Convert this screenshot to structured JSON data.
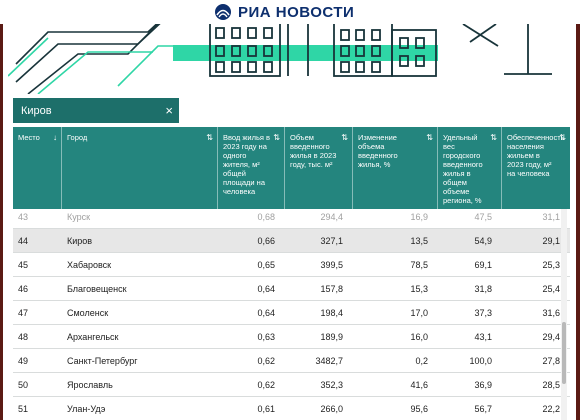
{
  "header": {
    "brand": "РИА НОВОСТИ"
  },
  "search": {
    "value": "Киров",
    "clear_icon": "×"
  },
  "table": {
    "columns": [
      {
        "label": "Место",
        "sort_icon": "↓"
      },
      {
        "label": "Город",
        "sort_icon": "⇅"
      },
      {
        "label": "Ввод жилья в 2023 году на одного жителя, м² общей площади на человека",
        "sort_icon": "⇅"
      },
      {
        "label": "Объем введенного жилья в 2023 году, тыс. м²",
        "sort_icon": "⇅"
      },
      {
        "label": "Изменение объема введенного жилья, %",
        "sort_icon": "⇅"
      },
      {
        "label": "Удельный вес городского введенного жилья в общем объеме региона, %",
        "sort_icon": "⇅"
      },
      {
        "label": "Обеспеченность населения жильем в 2023 году, м² на человека",
        "sort_icon": "⇅"
      }
    ],
    "rows": [
      [
        "43",
        "Курск",
        "0,68",
        "294,4",
        "16,9",
        "47,5",
        "31,1"
      ],
      [
        "44",
        "Киров",
        "0,66",
        "327,1",
        "13,5",
        "54,9",
        "29,1"
      ],
      [
        "45",
        "Хабаровск",
        "0,65",
        "399,5",
        "78,5",
        "69,1",
        "25,3"
      ],
      [
        "46",
        "Благовещенск",
        "0,64",
        "157,8",
        "15,3",
        "31,8",
        "25,4"
      ],
      [
        "47",
        "Смоленск",
        "0,64",
        "198,4",
        "17,0",
        "37,3",
        "31,6"
      ],
      [
        "48",
        "Архангельск",
        "0,63",
        "189,9",
        "16,0",
        "43,1",
        "29,4"
      ],
      [
        "49",
        "Санкт-Петербург",
        "0,62",
        "3482,7",
        "0,2",
        "100,0",
        "27,8"
      ],
      [
        "50",
        "Ярославль",
        "0,62",
        "352,3",
        "41,6",
        "36,9",
        "28,5"
      ],
      [
        "51",
        "Улан-Удэ",
        "0,61",
        "266,0",
        "95,6",
        "56,7",
        "22,2"
      ]
    ],
    "highlighted_row_index": 1,
    "faded_row_index": 0
  },
  "colors": {
    "header_teal": "#24857e",
    "search_teal": "#1d6f6a",
    "illustration_green": "#2fd6a6",
    "brand_navy": "#0d2f6e"
  }
}
